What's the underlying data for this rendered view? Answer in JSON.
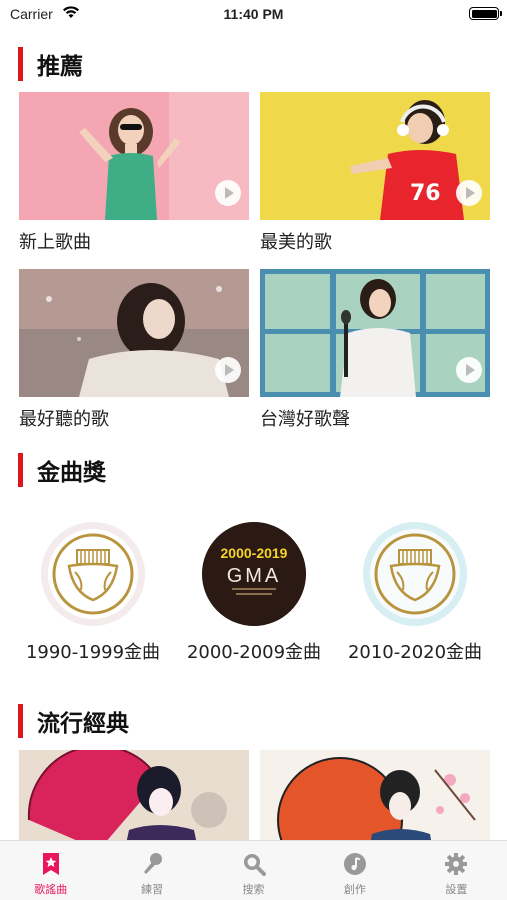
{
  "status_bar": {
    "carrier": "Carrier",
    "time": "11:40 PM"
  },
  "sections": {
    "recommended": {
      "title": "推薦",
      "cards": [
        {
          "label": "新上歌曲"
        },
        {
          "label": "最美的歌"
        },
        {
          "label": "最好聽的歌"
        },
        {
          "label": "台灣好歌聲"
        }
      ]
    },
    "awards": {
      "title": "金曲獎",
      "items": [
        {
          "label": "1990-1999金曲"
        },
        {
          "label": "2000-2009金曲",
          "badge_year": "2000-2019",
          "badge_logo": "GMA"
        },
        {
          "label": "2010-2020金曲"
        }
      ]
    },
    "classics": {
      "title": "流行經典"
    }
  },
  "tabbar": {
    "tabs": [
      {
        "label": "歌謠曲",
        "icon": "bookmark-star-icon",
        "active": true
      },
      {
        "label": "練習",
        "icon": "microphone-icon"
      },
      {
        "label": "搜索",
        "icon": "search-icon"
      },
      {
        "label": "創作",
        "icon": "music-note-icon"
      },
      {
        "label": "設置",
        "icon": "gear-icon"
      }
    ]
  },
  "colors": {
    "accent": "#e0141e",
    "active_tab": "#e8175d",
    "inactive_tab": "#999999"
  }
}
